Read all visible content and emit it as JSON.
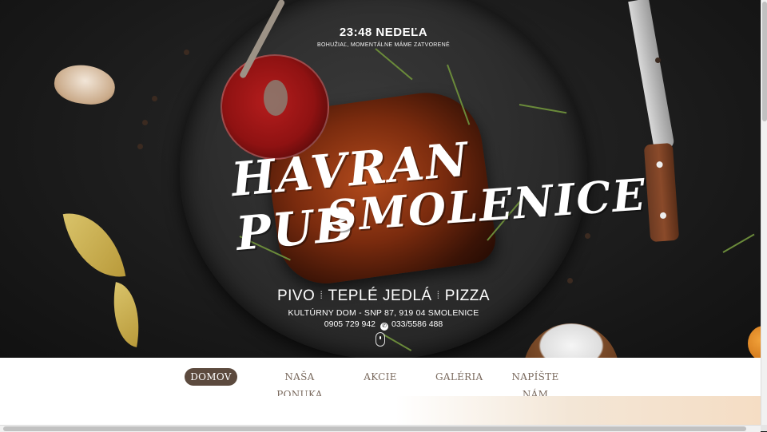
{
  "status": {
    "time": "23:48 NEDEĽA",
    "message": "BOHUŽIAĽ, MOMENTÁLNE MÁME ZATVORENÉ"
  },
  "logo": {
    "line1": "HAVRAN PUB",
    "line2": "SMOLENICE"
  },
  "services": [
    "PIVO",
    "TEPLÉ JEDLÁ",
    "PIZZA"
  ],
  "address": "KULTÚRNY DOM - SNP 87, 919 04 SMOLENICE",
  "contacts": {
    "phone1": "0905 729 942",
    "phone2": "033/5586 488",
    "phone_icon": "phone-icon"
  },
  "nav": {
    "items": [
      {
        "label": "DOMOV",
        "active": true
      },
      {
        "label": "NAŠA PONUKA",
        "active": false
      },
      {
        "label": "AKCIE",
        "active": false
      },
      {
        "label": "GALÉRIA",
        "active": false
      },
      {
        "label": "NAPÍŠTE NÁM",
        "active": false
      }
    ]
  },
  "colors": {
    "nav_active_bg": "#5c4a3e",
    "nav_text": "#7a6a5e",
    "hero_bg": "#1c1c1c"
  }
}
